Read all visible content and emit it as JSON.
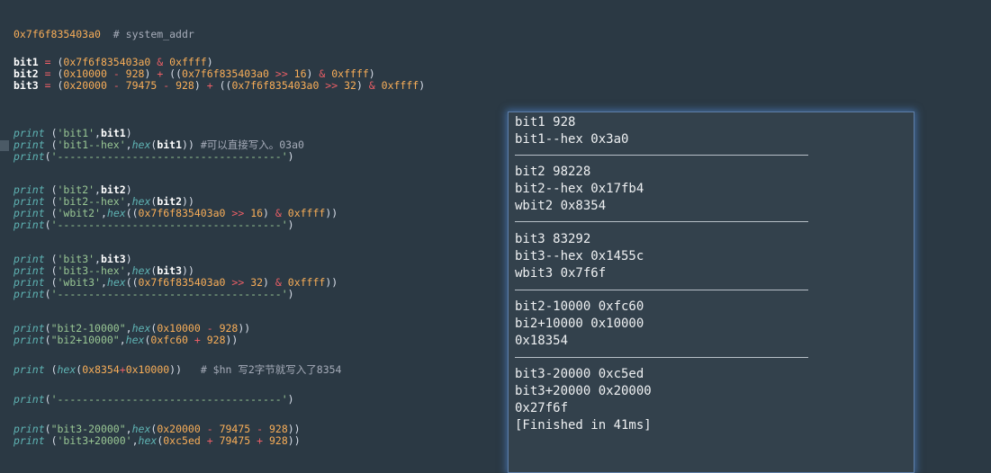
{
  "editor": {
    "header_addr": "0x7f6f835403a0",
    "header_comment": "# system_addr",
    "bit_defs": {
      "bit1": "bit1",
      "eq": " = ",
      "open": "(",
      "close": ")",
      "plus": " + ",
      "minus": " - ",
      "amp": " & ",
      "shr": " >> ",
      "addr": "0x7f6f835403a0",
      "ffff": "0xffff",
      "bit2": "bit2",
      "bit3": "bit3",
      "h10000": "0x10000",
      "h20000": "0x20000",
      "n928": "928",
      "n79475": "79475",
      "n16": "16",
      "n32": "32",
      "dbl_open": "((",
      "close_amp_tail": ")"
    },
    "print_kw": "print",
    "hex_kw": "hex",
    "comment_write": "#可以直接写入。03a0",
    "comment_hn": "# $hn 写2字节就写入了8354",
    "strings": {
      "bit1": "'bit1'",
      "bit1hex": "'bit1--hex'",
      "sep": "'------------------------------------'",
      "bit2": "'bit2'",
      "bit2hex": "'bit2--hex'",
      "wbit2": "'wbit2'",
      "bit3": "'bit3'",
      "bit3hex": "'bit3--hex'",
      "wbit3": "'wbit3'",
      "bit2m": "\"bit2-10000\"",
      "bi2p": "\"bi2+10000\"",
      "bit3m": "\"bit3-20000\"",
      "bit3p": "'bit3+20000'"
    },
    "nums": {
      "fc60": "0xfc60",
      "n928": "928",
      "h8354": "0x8354",
      "h10000": "0x10000",
      "h20000": "0x20000",
      "c5ed": "0xc5ed",
      "n79475": "79475"
    }
  },
  "output": {
    "lines": [
      "bit1 928",
      "bit1--hex 0x3a0",
      "bit2 98228",
      "bit2--hex 0x17fb4",
      "wbit2 0x8354",
      "bit3 83292",
      "bit3--hex 0x1455c",
      "wbit3 0x7f6f",
      "bit2-10000 0xfc60",
      "bi2+10000 0x10000",
      "0x18354",
      "bit3-20000 0xc5ed",
      "bit3+20000 0x20000",
      "0x27f6f",
      "[Finished in 41ms]"
    ]
  },
  "colors": {
    "background": "#2b3944",
    "number": "#f9ae58",
    "operator": "#ec5f66",
    "function": "#5fb4b4",
    "string": "#99c794",
    "comment": "#a6acb9",
    "panel_border": "#5f7fa8"
  }
}
